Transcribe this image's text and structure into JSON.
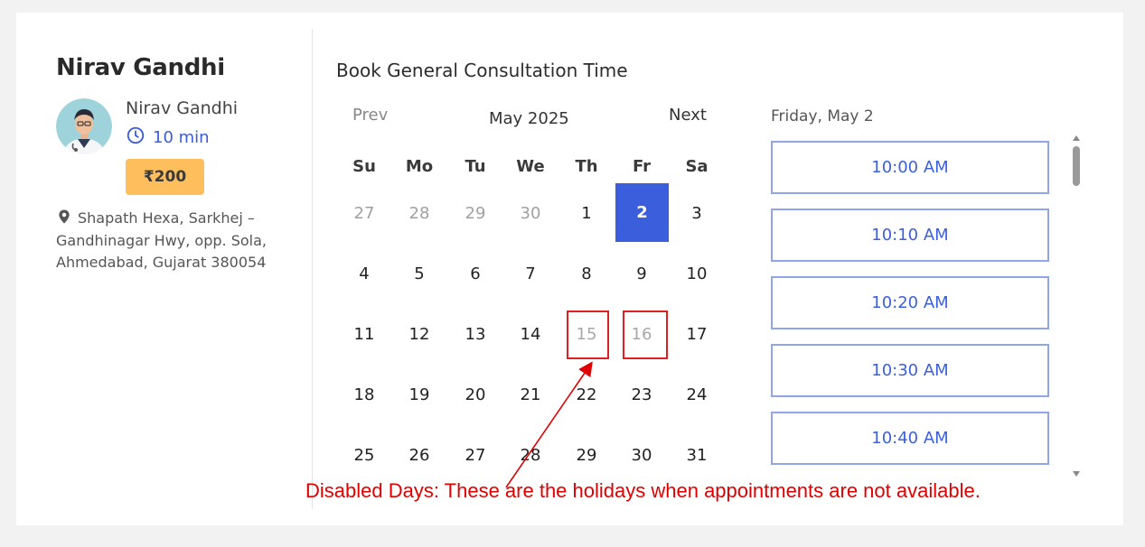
{
  "doctor": {
    "title": "Nirav Gandhi",
    "name": "Nirav Gandhi",
    "duration": "10 min",
    "price": "₹200",
    "address": "Shapath Hexa, Sarkhej – Gandhinagar Hwy, opp. Sola, Ahmedabad, Gujarat 380054"
  },
  "booking": {
    "title": "Book General Consultation Time",
    "prev_label": "Prev",
    "next_label": "Next",
    "month_label": "May 2025",
    "weekdays": [
      "Su",
      "Mo",
      "Tu",
      "We",
      "Th",
      "Fr",
      "Sa"
    ],
    "weeks": [
      [
        "27",
        "28",
        "29",
        "30",
        "1",
        "2",
        "3"
      ],
      [
        "4",
        "5",
        "6",
        "7",
        "8",
        "9",
        "10"
      ],
      [
        "11",
        "12",
        "13",
        "14",
        "15",
        "16",
        "17"
      ],
      [
        "18",
        "19",
        "20",
        "21",
        "22",
        "23",
        "24"
      ],
      [
        "25",
        "26",
        "27",
        "28",
        "29",
        "30",
        "31"
      ]
    ],
    "outside_month_days": [
      "27",
      "28",
      "29",
      "30"
    ],
    "selected_day": "2",
    "disabled_days": [
      "15",
      "16"
    ]
  },
  "slots": {
    "date_label": "Friday, May 2",
    "times": [
      "10:00 AM",
      "10:10 AM",
      "10:20 AM",
      "10:30 AM",
      "10:40 AM"
    ]
  },
  "annotation": {
    "text": "Disabled Days: These are the holidays when appointments are not available."
  },
  "colors": {
    "accent": "#3b5fdc",
    "price_badge": "#ffbe5c",
    "annotation_red": "#e00000"
  }
}
